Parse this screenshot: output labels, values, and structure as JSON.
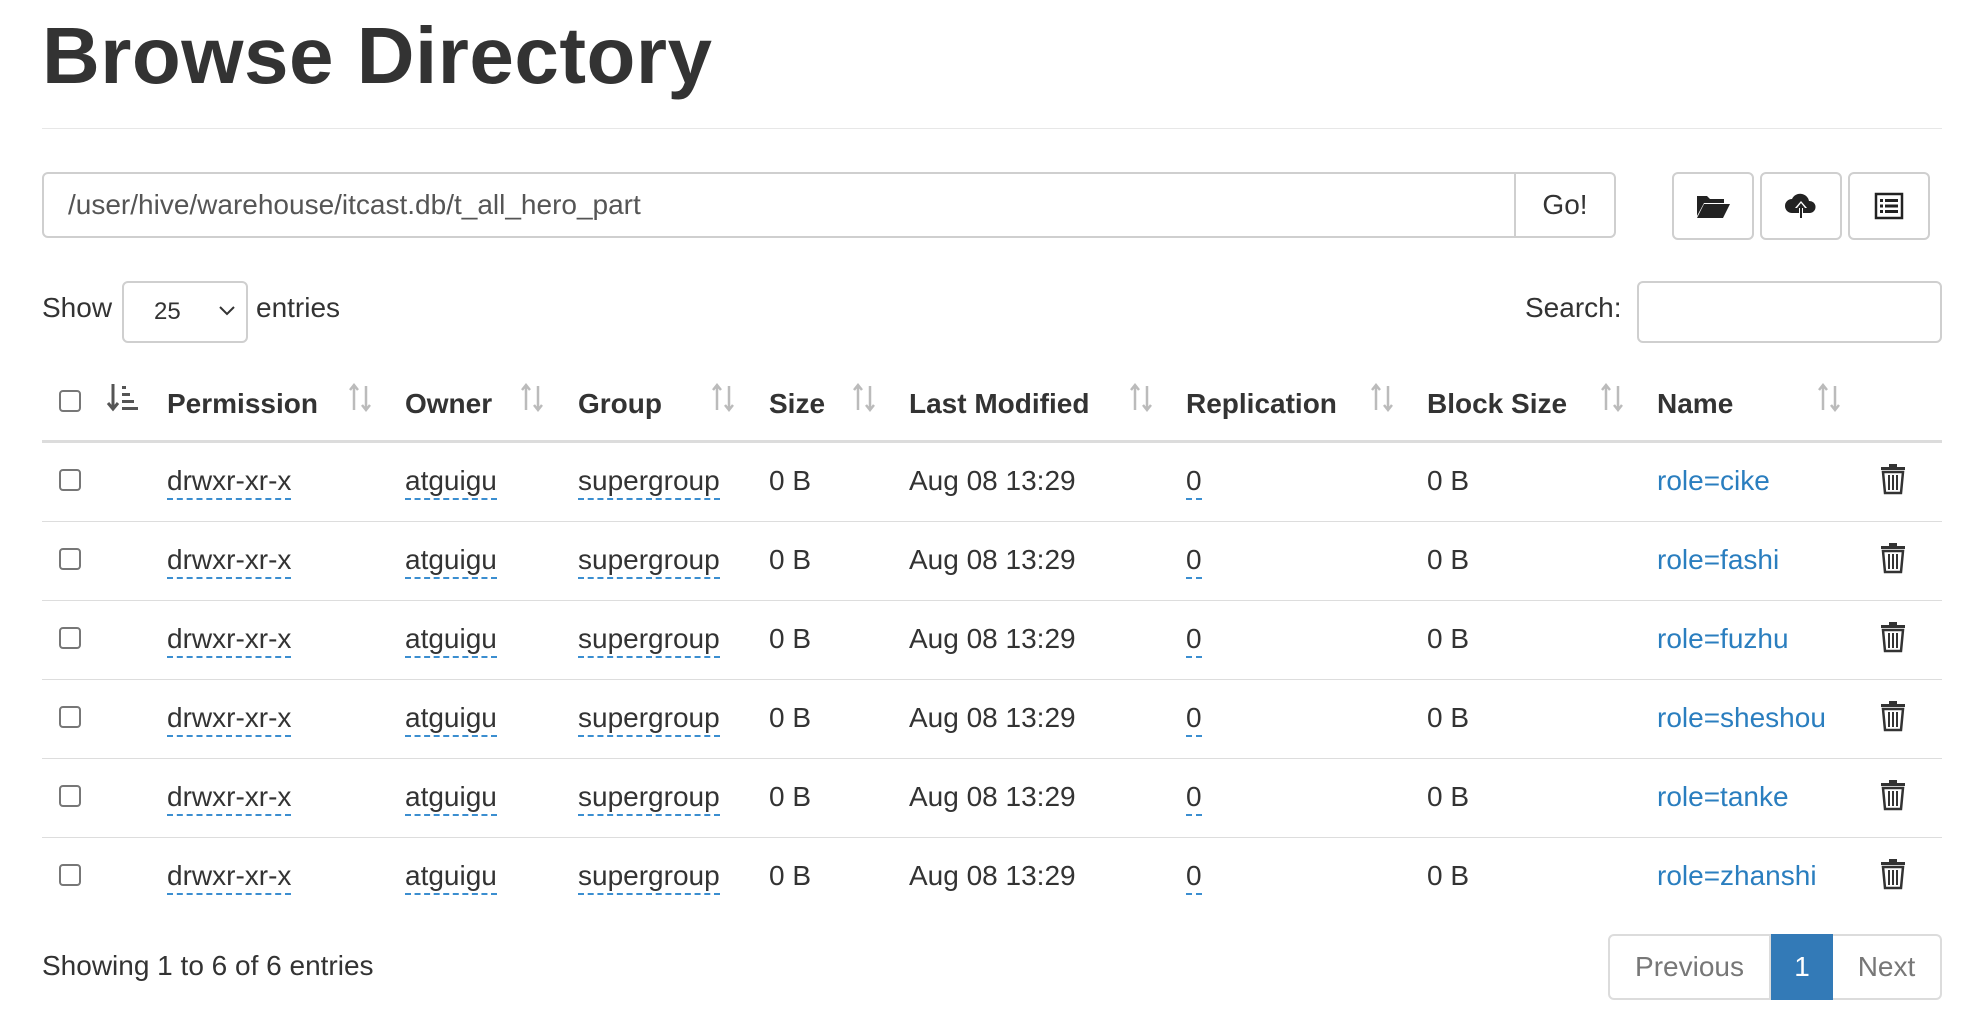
{
  "page": {
    "title": "Browse Directory"
  },
  "pathbar": {
    "path": "/user/hive/warehouse/itcast.db/t_all_hero_part",
    "go_label": "Go!"
  },
  "toolbar": {
    "icons": [
      "folder-open-icon",
      "cloud-upload-icon",
      "list-icon"
    ]
  },
  "controls": {
    "show_label": "Show",
    "entries_value": "25",
    "entries_label": "entries",
    "search_label": "Search:",
    "search_value": ""
  },
  "table": {
    "columns": [
      "Permission",
      "Owner",
      "Group",
      "Size",
      "Last Modified",
      "Replication",
      "Block Size",
      "Name"
    ],
    "rows": [
      {
        "permission": "drwxr-xr-x",
        "owner": "atguigu",
        "group": "supergroup",
        "size": "0 B",
        "modified": "Aug 08 13:29",
        "replication": "0",
        "block_size": "0 B",
        "name": "role=cike"
      },
      {
        "permission": "drwxr-xr-x",
        "owner": "atguigu",
        "group": "supergroup",
        "size": "0 B",
        "modified": "Aug 08 13:29",
        "replication": "0",
        "block_size": "0 B",
        "name": "role=fashi"
      },
      {
        "permission": "drwxr-xr-x",
        "owner": "atguigu",
        "group": "supergroup",
        "size": "0 B",
        "modified": "Aug 08 13:29",
        "replication": "0",
        "block_size": "0 B",
        "name": "role=fuzhu"
      },
      {
        "permission": "drwxr-xr-x",
        "owner": "atguigu",
        "group": "supergroup",
        "size": "0 B",
        "modified": "Aug 08 13:29",
        "replication": "0",
        "block_size": "0 B",
        "name": "role=sheshou"
      },
      {
        "permission": "drwxr-xr-x",
        "owner": "atguigu",
        "group": "supergroup",
        "size": "0 B",
        "modified": "Aug 08 13:29",
        "replication": "0",
        "block_size": "0 B",
        "name": "role=tanke"
      },
      {
        "permission": "drwxr-xr-x",
        "owner": "atguigu",
        "group": "supergroup",
        "size": "0 B",
        "modified": "Aug 08 13:29",
        "replication": "0",
        "block_size": "0 B",
        "name": "role=zhanshi"
      }
    ]
  },
  "footer": {
    "info": "Showing 1 to 6 of 6 entries",
    "previous": "Previous",
    "current_page": "1",
    "next": "Next"
  },
  "colors": {
    "link": "#2a7ebf",
    "active_page": "#337ab7"
  }
}
